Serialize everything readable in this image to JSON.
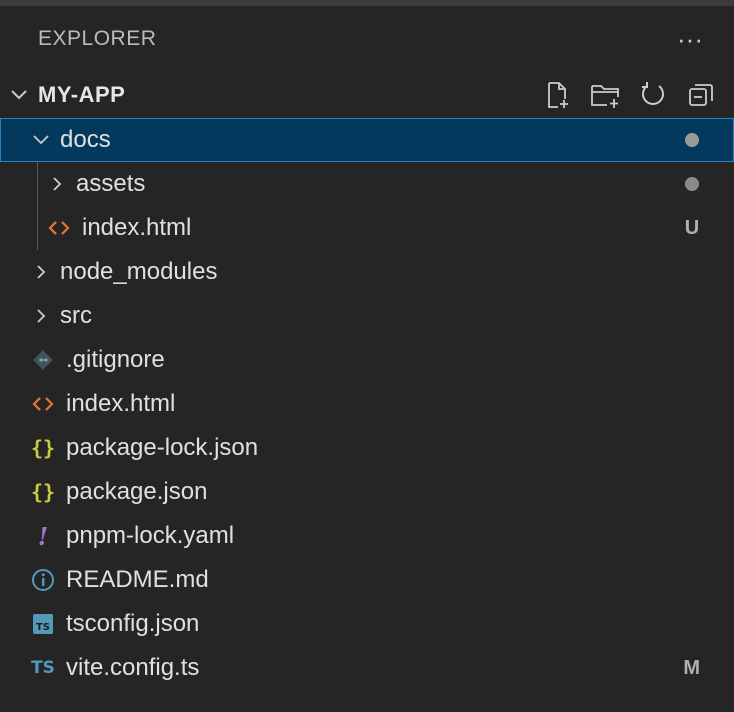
{
  "panel": {
    "title": "EXPLORER",
    "more_label": "···"
  },
  "section": {
    "title": "MY-APP",
    "actions": [
      "new-file-icon",
      "new-folder-icon",
      "refresh-icon",
      "collapse-all-icon"
    ]
  },
  "tree": [
    {
      "label": "docs",
      "kind": "folder-open",
      "depth": 0,
      "selected": true,
      "decoration": "dot"
    },
    {
      "label": "assets",
      "kind": "folder-closed",
      "depth": 1,
      "decoration": "dot"
    },
    {
      "label": "index.html",
      "kind": "html",
      "depth": 1,
      "decoration": "U"
    },
    {
      "label": "node_modules",
      "kind": "folder-closed",
      "depth": 0
    },
    {
      "label": "src",
      "kind": "folder-closed",
      "depth": 0
    },
    {
      "label": ".gitignore",
      "kind": "git",
      "depth": 0
    },
    {
      "label": "index.html",
      "kind": "html",
      "depth": 0
    },
    {
      "label": "package-lock.json",
      "kind": "json",
      "depth": 0
    },
    {
      "label": "package.json",
      "kind": "json",
      "depth": 0
    },
    {
      "label": "pnpm-lock.yaml",
      "kind": "yaml",
      "depth": 0
    },
    {
      "label": "README.md",
      "kind": "info",
      "depth": 0
    },
    {
      "label": "tsconfig.json",
      "kind": "tsconfig",
      "depth": 0
    },
    {
      "label": "vite.config.ts",
      "kind": "ts",
      "depth": 0,
      "decoration": "M"
    }
  ],
  "colors": {
    "background": "#252526",
    "selection": "#04395e",
    "html_icon": "#e37933",
    "json_icon": "#cbcb41",
    "yaml_icon": "#a074c4",
    "info_icon": "#519aba",
    "ts_icon": "#519aba",
    "git_icon": "#41535b"
  }
}
